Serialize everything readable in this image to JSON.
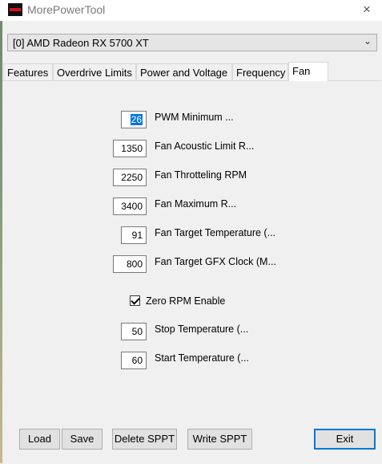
{
  "window": {
    "title": "MorePowerTool",
    "close_icon": "×"
  },
  "gpu_select": {
    "value": "[0] AMD Radeon RX 5700 XT",
    "chevron": "⌄"
  },
  "tabs": [
    {
      "label": "Features"
    },
    {
      "label": "Overdrive Limits"
    },
    {
      "label": "Power and Voltage"
    },
    {
      "label": "Frequency"
    },
    {
      "label": "Fan",
      "active": true
    }
  ],
  "fan": {
    "fields": [
      {
        "value": "26",
        "label": "PWM Minimum ..."
      },
      {
        "value": "1350",
        "label": "Fan Acoustic Limit R..."
      },
      {
        "value": "2250",
        "label": "Fan Throtteling RPM"
      },
      {
        "value": "3400",
        "label": "Fan Maximum R..."
      },
      {
        "value": "91",
        "label": "Fan Target Temperature (..."
      },
      {
        "value": "800",
        "label": "Fan Target GFX Clock (M..."
      }
    ],
    "zero_rpm": {
      "label": "Zero RPM Enable",
      "checked": true
    },
    "zero_rpm_fields": [
      {
        "value": "50",
        "label": "Stop Temperature (..."
      },
      {
        "value": "60",
        "label": "Start Temperature (..."
      }
    ]
  },
  "buttons": {
    "load": "Load",
    "save": "Save",
    "delete_sppt": "Delete SPPT",
    "write_sppt": "Write SPPT",
    "exit": "Exit"
  }
}
